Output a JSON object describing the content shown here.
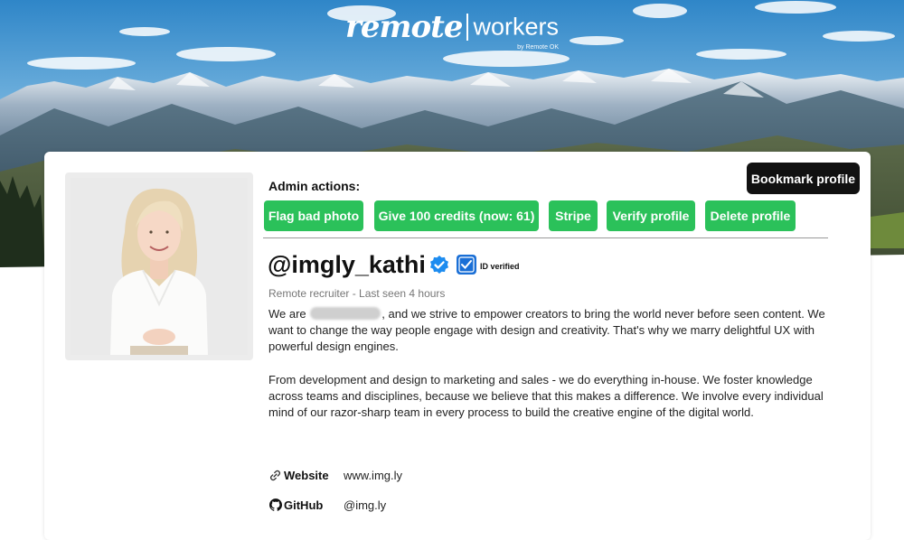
{
  "brand": {
    "name_part1": "remote",
    "name_part2": "workers",
    "byline": "by Remote OK"
  },
  "admin": {
    "label": "Admin actions:",
    "buttons": [
      {
        "label": "Flag bad photo"
      },
      {
        "label": "Give 100 credits (now: 61)"
      },
      {
        "label": "Stripe"
      },
      {
        "label": "Verify profile"
      },
      {
        "label": "Delete profile"
      }
    ],
    "button_color": "#2bc15a"
  },
  "bookmark": {
    "label": "Bookmark profile"
  },
  "profile": {
    "username": "@imgly_kathi",
    "verified_icon": "verified-check-icon",
    "id_verified_label": "ID verified",
    "subtitle": "Remote recruiter - Last seen 4 hours",
    "bio_p1_before": "We are",
    "bio_p1_after": ", and we strive to empower creators to bring the world never before seen content. We want to change the way people engage with design and creativity. That's why we marry delightful UX with powerful design engines.",
    "bio_p2": "From development and design to marketing and sales - we do everything in-house. We foster knowledge across teams and disciplines, because we believe that this makes a difference. We involve every individual mind of our razor-sharp team in every process to build the creative engine of the digital world."
  },
  "links": [
    {
      "icon": "link-icon",
      "label": "Website",
      "value": "www.img.ly"
    },
    {
      "icon": "github-icon",
      "label": "GitHub",
      "value": "@img.ly"
    }
  ],
  "colors": {
    "accent_green": "#2bc15a",
    "verified_blue": "#1d8cf0",
    "id_blue": "#1a6fd6"
  }
}
